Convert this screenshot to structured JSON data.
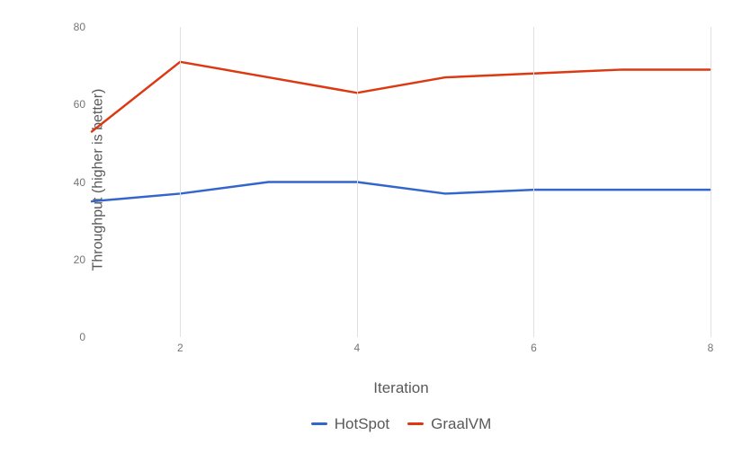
{
  "chart_data": {
    "type": "line",
    "title": "",
    "xlabel": "Iteration",
    "ylabel": "Throughput (higher is better)",
    "xlim": [
      1,
      8
    ],
    "ylim": [
      0,
      80
    ],
    "x_ticks": [
      2,
      4,
      6,
      8
    ],
    "y_ticks": [
      0,
      20,
      40,
      60,
      80
    ],
    "x": [
      1,
      2,
      3,
      4,
      5,
      6,
      7,
      8
    ],
    "series": [
      {
        "name": "HotSpot",
        "color": "#3366cc",
        "values": [
          35,
          37,
          40,
          40,
          37,
          38,
          38,
          38
        ]
      },
      {
        "name": "GraalVM",
        "color": "#dc3912",
        "values": [
          53,
          71,
          67,
          63,
          67,
          68,
          69,
          69
        ]
      }
    ],
    "grid": {
      "vertical_at_x": [
        2,
        4,
        6,
        8
      ]
    },
    "legend_position": "bottom"
  }
}
